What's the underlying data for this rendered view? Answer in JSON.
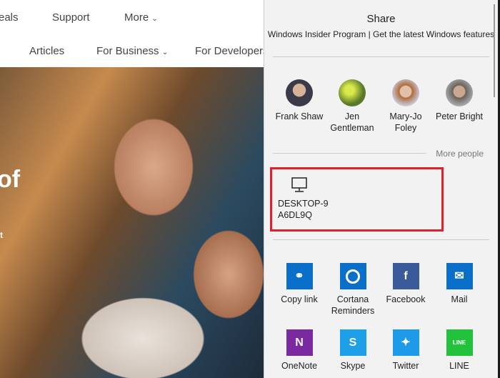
{
  "nav": {
    "row1": [
      "eals",
      "Support",
      "More"
    ],
    "row2": [
      "Articles",
      "For Business",
      "For Developers"
    ]
  },
  "hero": {
    "text1": "of",
    "text2": "t"
  },
  "share": {
    "title": "Share",
    "subtitle": "Windows Insider Program | Get the latest Windows features",
    "people": [
      {
        "line1": "Frank Shaw",
        "line2": ""
      },
      {
        "line1": "Jen",
        "line2": "Gentleman"
      },
      {
        "line1": "Mary-Jo",
        "line2": "Foley"
      },
      {
        "line1": "Peter Bright",
        "line2": ""
      }
    ],
    "more_people": "More people",
    "device": {
      "line1": "DESKTOP-9",
      "line2": "A6DL9Q",
      "icon": "monitor-icon"
    },
    "apps": [
      {
        "line1": "Copy link",
        "line2": "",
        "color": "#0a6fc8",
        "icon": "link-icon"
      },
      {
        "line1": "Cortana",
        "line2": "Reminders",
        "color": "#0a6fc8",
        "icon": "cortana-icon"
      },
      {
        "line1": "Facebook",
        "line2": "",
        "color": "#3b5a9a",
        "icon": "facebook-icon"
      },
      {
        "line1": "Mail",
        "line2": "",
        "color": "#0a6fc8",
        "icon": "mail-icon"
      },
      {
        "line1": "OneNote",
        "line2": "",
        "color": "#7a2a9e",
        "icon": "onenote-icon"
      },
      {
        "line1": "Skype",
        "line2": "",
        "color": "#1ea0e8",
        "icon": "skype-icon"
      },
      {
        "line1": "Twitter",
        "line2": "",
        "color": "#1e9be8",
        "icon": "twitter-icon"
      },
      {
        "line1": "LINE",
        "line2": "",
        "color": "#22c23c",
        "icon": "line-icon"
      }
    ]
  }
}
